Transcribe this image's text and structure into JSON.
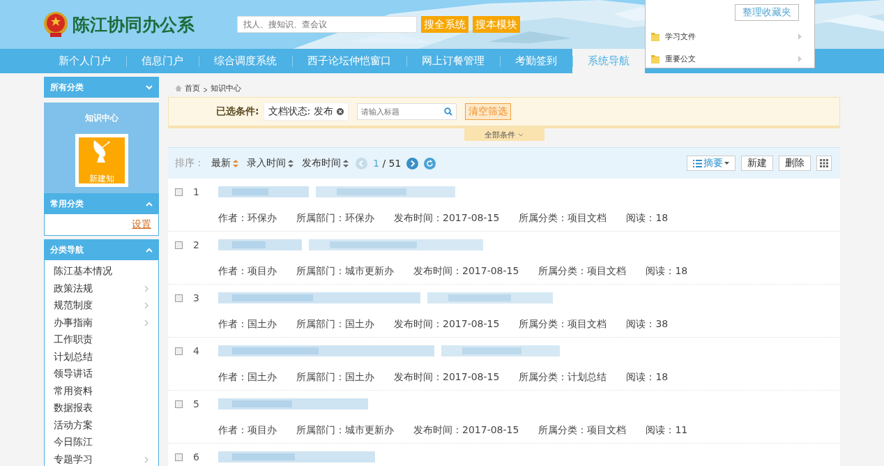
{
  "header": {
    "title": "陈江协同办公系",
    "search": {
      "placeholder": "找人、搜知识、查会议"
    },
    "buttons": [
      "搜全系统",
      "搜本模块"
    ]
  },
  "nav": {
    "tabs": [
      {
        "label": "新个人门户",
        "selected": false
      },
      {
        "label": "信息门户",
        "selected": false
      },
      {
        "label": "综合调度系统",
        "selected": false
      },
      {
        "label": "西子论坛仲恺窗口",
        "selected": false
      },
      {
        "label": "网上订餐管理",
        "selected": false
      },
      {
        "label": "考勤签到",
        "selected": false
      },
      {
        "label": "系统导航",
        "selected": true
      }
    ]
  },
  "favorites_menu": {
    "button": "整理收藏夹",
    "items": [
      {
        "label": "学习文件"
      },
      {
        "label": "重要公文"
      }
    ]
  },
  "sidebar": {
    "all_categories": {
      "title": "所有分类",
      "expanded": false
    },
    "module": {
      "title": "知识中心",
      "tile_label": "新建知"
    },
    "common": {
      "title": "常用分类",
      "expanded": true,
      "link": "设置"
    },
    "category_nav": {
      "title": "分类导航",
      "expanded": true,
      "items": [
        {
          "label": "陈江基本情况",
          "has_submenu": false
        },
        {
          "label": "政策法规",
          "has_submenu": true
        },
        {
          "label": "规范制度",
          "has_submenu": true
        },
        {
          "label": "办事指南",
          "has_submenu": true
        },
        {
          "label": "工作职责",
          "has_submenu": false
        },
        {
          "label": "计划总结",
          "has_submenu": false
        },
        {
          "label": "领导讲话",
          "has_submenu": false
        },
        {
          "label": "常用资料",
          "has_submenu": false
        },
        {
          "label": "数据报表",
          "has_submenu": false
        },
        {
          "label": "活动方案",
          "has_submenu": false
        },
        {
          "label": "今日陈江",
          "has_submenu": false
        },
        {
          "label": "专题学习",
          "has_submenu": true
        }
      ]
    }
  },
  "breadcrumb": [
    "首页",
    "知识中心"
  ],
  "filter": {
    "label": "已选条件:",
    "tags": [
      "文档状态: 发布"
    ],
    "search": {
      "placeholder": "请输入标题"
    },
    "clear_button": "清空筛选",
    "more": "全部条件"
  },
  "toolbar": {
    "sort_label": "排序：",
    "sorts": [
      {
        "label": "最新",
        "selected": true
      },
      {
        "label": "录入时间",
        "selected": false
      },
      {
        "label": "发布时间",
        "selected": false
      }
    ],
    "page": "1",
    "total": "/ 51",
    "view": "摘要",
    "buttons": [
      "新建",
      "删除"
    ]
  },
  "rows": [
    {
      "index": "1",
      "checked": false,
      "meta": [
        "作者：环保办",
        "所属部门：环保办",
        "发布时间：2017-08-15",
        "所属分类：项目文档",
        "阅读：18"
      ]
    },
    {
      "index": "2",
      "checked": false,
      "meta": [
        "作者：项目办",
        "所属部门：城市更新办",
        "发布时间：2017-08-15",
        "所属分类：项目文档",
        "阅读：18"
      ]
    },
    {
      "index": "3",
      "checked": false,
      "meta": [
        "作者：国土办",
        "所属部门：国土办",
        "发布时间：2017-08-15",
        "所属分类：项目文档",
        "阅读：38"
      ]
    },
    {
      "index": "4",
      "checked": false,
      "meta": [
        "作者：国土办",
        "所属部门：国土办",
        "发布时间：2017-08-15",
        "所属分类：计划总结",
        "阅读：18"
      ]
    },
    {
      "index": "5",
      "checked": false,
      "meta": [
        "作者：项目办",
        "所属部门：城市更新办",
        "发布时间：2017-08-15",
        "所属分类：项目文档",
        "阅读：11"
      ]
    },
    {
      "index": "6",
      "checked": false
    }
  ]
}
